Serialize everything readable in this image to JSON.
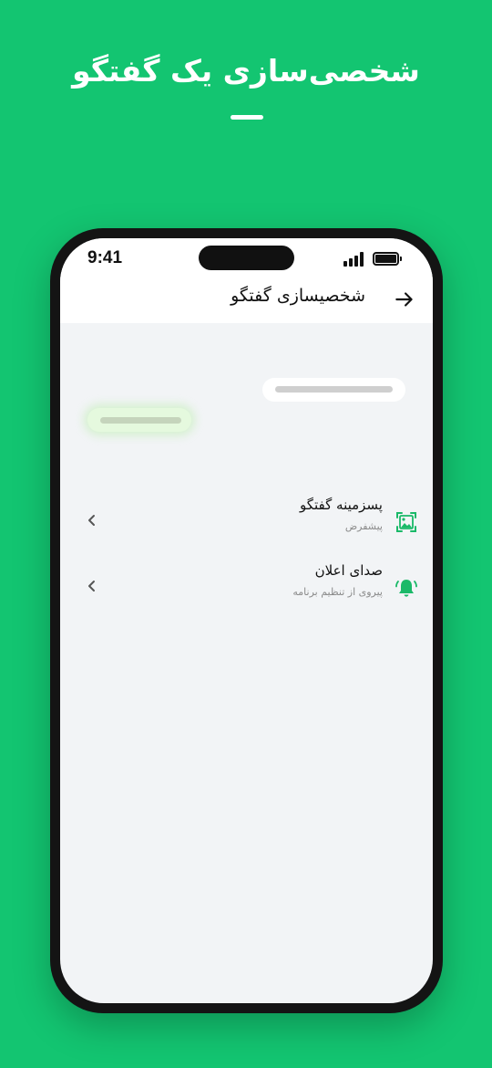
{
  "promo": {
    "title": "شخصی‌سازی یک گفتگو"
  },
  "status_bar": {
    "time": "9:41",
    "icons": [
      "signal-icon",
      "battery-icon"
    ]
  },
  "app_bar": {
    "title": "شخصیسازی گفتگو",
    "back_icon": "arrow-right-icon"
  },
  "settings": [
    {
      "title": "پسزمینه گفتگو",
      "subtitle": "پیشفرض",
      "icon": "wallpaper-image-icon",
      "trailing_icon": "chevron-left-icon"
    },
    {
      "title": "صدای اعلان",
      "subtitle": "پیروی از تنظیم برنامه",
      "icon": "bell-ringing-icon",
      "trailing_icon": "chevron-left-icon"
    }
  ],
  "colors": {
    "brand": "#13c571",
    "icon_accent": "#1ab968",
    "screen_bg": "#f2f4f6",
    "incoming_bubble": "#e5f9de"
  }
}
